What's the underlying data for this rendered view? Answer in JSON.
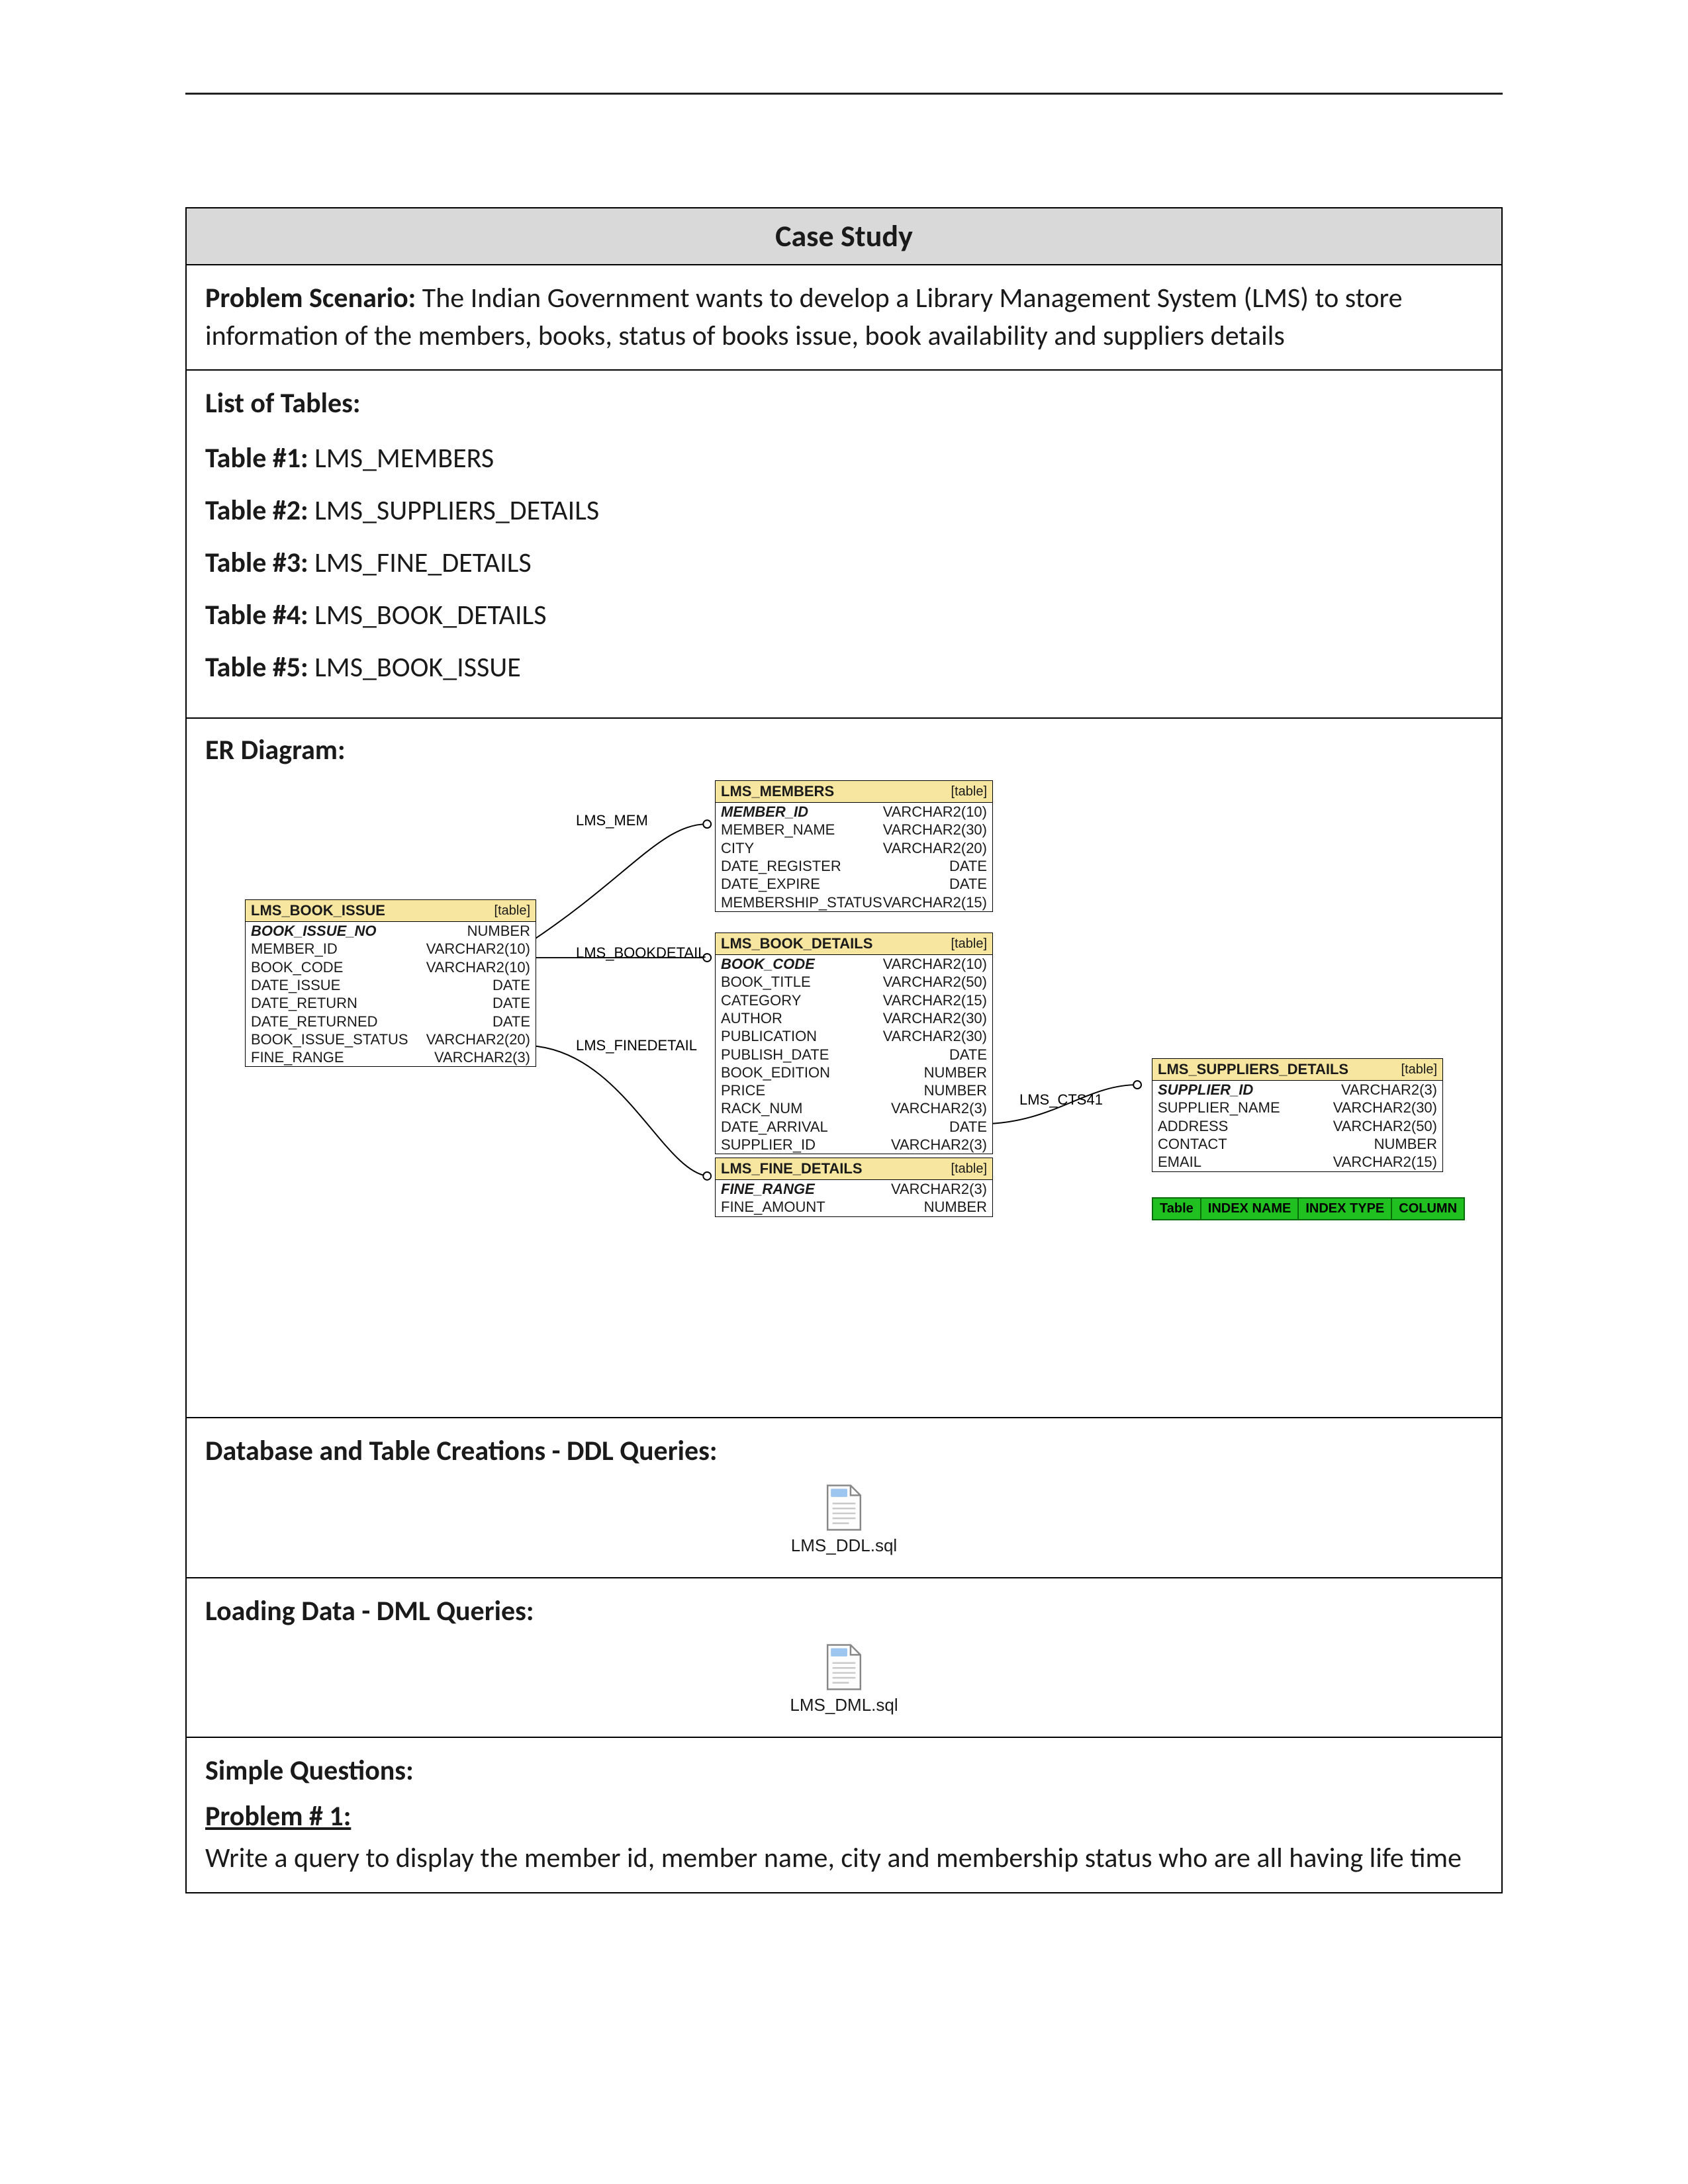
{
  "header_title": "Case Study",
  "scenario_label": "Problem Scenario:",
  "scenario_text": "The Indian Government wants to develop a Library Management System (LMS) to store information of the members, books, status of books issue, book availability and suppliers details",
  "tables_heading": "List of Tables:",
  "tables": [
    {
      "label": "Table #1:",
      "name": "LMS_MEMBERS"
    },
    {
      "label": "Table #2:",
      "name": "LMS_SUPPLIERS_DETAILS"
    },
    {
      "label": "Table #3:",
      "name": "LMS_FINE_DETAILS"
    },
    {
      "label": "Table #4:",
      "name": "LMS_BOOK_DETAILS"
    },
    {
      "label": "Table #5:",
      "name": "LMS_BOOK_ISSUE"
    }
  ],
  "er_heading": "ER Diagram:",
  "er_relations": {
    "mem": "LMS_MEM",
    "bookdetail": "LMS_BOOKDETAIL",
    "finedetail": "LMS_FINEDETAIL",
    "cts41": "LMS_CTS41"
  },
  "table_type_label": "[table]",
  "entities": {
    "book_issue": {
      "name": "LMS_BOOK_ISSUE",
      "rows": [
        {
          "c": "BOOK_ISSUE_NO",
          "t": "NUMBER",
          "pk": true
        },
        {
          "c": "MEMBER_ID",
          "t": "VARCHAR2(10)"
        },
        {
          "c": "BOOK_CODE",
          "t": "VARCHAR2(10)"
        },
        {
          "c": "DATE_ISSUE",
          "t": "DATE"
        },
        {
          "c": "DATE_RETURN",
          "t": "DATE"
        },
        {
          "c": "DATE_RETURNED",
          "t": "DATE"
        },
        {
          "c": "BOOK_ISSUE_STATUS",
          "t": "VARCHAR2(20)"
        },
        {
          "c": "FINE_RANGE",
          "t": "VARCHAR2(3)"
        }
      ]
    },
    "members": {
      "name": "LMS_MEMBERS",
      "rows": [
        {
          "c": "MEMBER_ID",
          "t": "VARCHAR2(10)",
          "pk": true
        },
        {
          "c": "MEMBER_NAME",
          "t": "VARCHAR2(30)"
        },
        {
          "c": "CITY",
          "t": "VARCHAR2(20)"
        },
        {
          "c": "DATE_REGISTER",
          "t": "DATE"
        },
        {
          "c": "DATE_EXPIRE",
          "t": "DATE"
        },
        {
          "c": "MEMBERSHIP_STATUS",
          "t": "VARCHAR2(15)"
        }
      ]
    },
    "book_details": {
      "name": "LMS_BOOK_DETAILS",
      "rows": [
        {
          "c": "BOOK_CODE",
          "t": "VARCHAR2(10)",
          "pk": true
        },
        {
          "c": "BOOK_TITLE",
          "t": "VARCHAR2(50)"
        },
        {
          "c": "CATEGORY",
          "t": "VARCHAR2(15)"
        },
        {
          "c": "AUTHOR",
          "t": "VARCHAR2(30)"
        },
        {
          "c": "PUBLICATION",
          "t": "VARCHAR2(30)"
        },
        {
          "c": "PUBLISH_DATE",
          "t": "DATE"
        },
        {
          "c": "BOOK_EDITION",
          "t": "NUMBER"
        },
        {
          "c": "PRICE",
          "t": "NUMBER"
        },
        {
          "c": "RACK_NUM",
          "t": "VARCHAR2(3)"
        },
        {
          "c": "DATE_ARRIVAL",
          "t": "DATE"
        },
        {
          "c": "SUPPLIER_ID",
          "t": "VARCHAR2(3)"
        }
      ]
    },
    "fine_details": {
      "name": "LMS_FINE_DETAILS",
      "rows": [
        {
          "c": "FINE_RANGE",
          "t": "VARCHAR2(3)",
          "pk": true
        },
        {
          "c": "FINE_AMOUNT",
          "t": "NUMBER"
        }
      ]
    },
    "suppliers": {
      "name": "LMS_SUPPLIERS_DETAILS",
      "rows": [
        {
          "c": "SUPPLIER_ID",
          "t": "VARCHAR2(3)",
          "pk": true
        },
        {
          "c": "SUPPLIER_NAME",
          "t": "VARCHAR2(30)"
        },
        {
          "c": "ADDRESS",
          "t": "VARCHAR2(50)"
        },
        {
          "c": "CONTACT",
          "t": "NUMBER"
        },
        {
          "c": "EMAIL",
          "t": "VARCHAR2(15)"
        }
      ]
    }
  },
  "legend": {
    "a": "Table",
    "b": "INDEX NAME",
    "c": "INDEX TYPE",
    "d": "COLUMN"
  },
  "ddl_heading": "Database and Table Creations - DDL Queries:",
  "ddl_file": "LMS_DDL.sql",
  "dml_heading": "Loading Data - DML Queries:",
  "dml_file": "LMS_DML.sql",
  "simple_q_heading": "Simple Questions:",
  "problem1_heading": "Problem # 1:",
  "problem1_text": "Write a query to display the member id, member name, city and membership status who are all having life time"
}
